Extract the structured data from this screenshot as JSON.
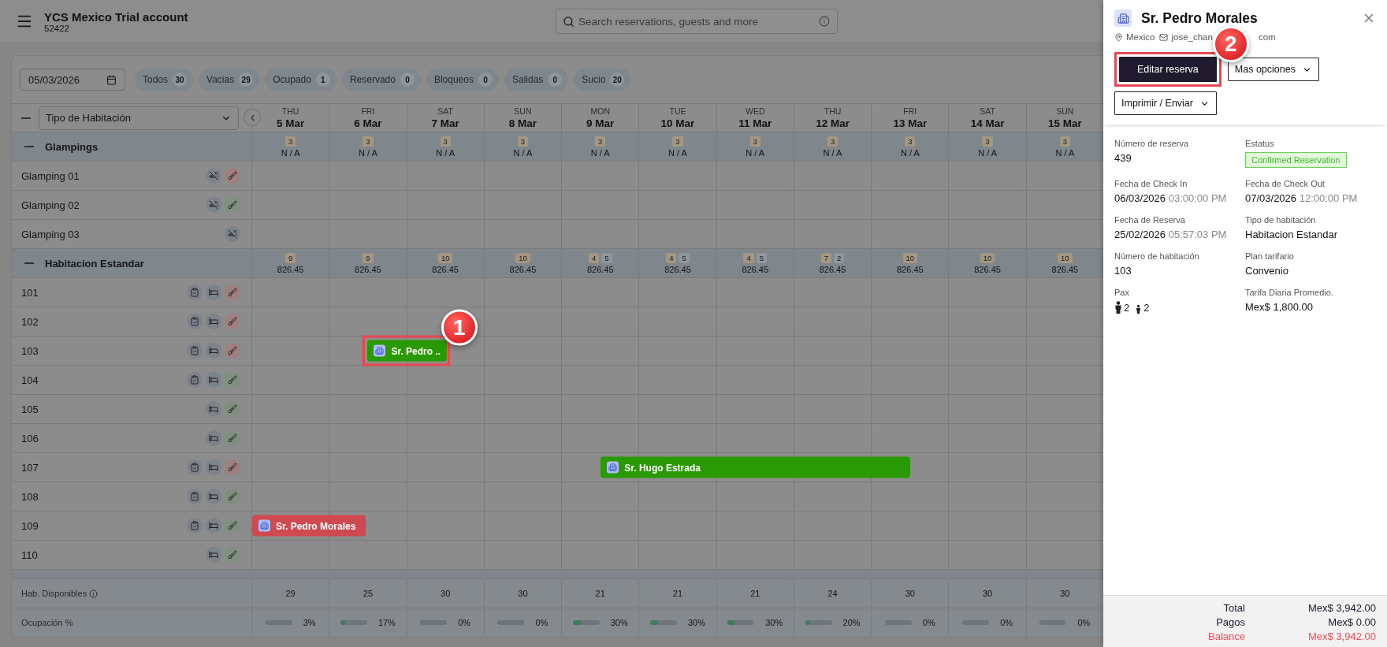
{
  "header": {
    "title": "YCS Mexico Trial account",
    "account_id": "52422",
    "search": {
      "placeholder": "Search reservations, guests and more"
    }
  },
  "filter": {
    "date": "05/03/2026",
    "chips": [
      {
        "label": "Todos",
        "count": "30"
      },
      {
        "label": "Vacias",
        "count": "29"
      },
      {
        "label": "Ocupado",
        "count": "1"
      },
      {
        "label": "Reservado",
        "count": "0"
      },
      {
        "label": "Bloqueos",
        "count": "0"
      },
      {
        "label": "Salidas",
        "count": "0"
      },
      {
        "label": "Sucio",
        "count": "20"
      }
    ]
  },
  "calendar": {
    "group_select": "Tipo de Habitación",
    "days": [
      {
        "weekday": "THU",
        "date": "5 Mar"
      },
      {
        "weekday": "FRI",
        "date": "6 Mar"
      },
      {
        "weekday": "SAT",
        "date": "7 Mar"
      },
      {
        "weekday": "SUN",
        "date": "8 Mar"
      },
      {
        "weekday": "MON",
        "date": "9 Mar"
      },
      {
        "weekday": "TUE",
        "date": "10 Mar"
      },
      {
        "weekday": "WED",
        "date": "11 Mar"
      },
      {
        "weekday": "THU",
        "date": "12 Mar"
      },
      {
        "weekday": "FRI",
        "date": "13 Mar"
      },
      {
        "weekday": "SAT",
        "date": "14 Mar"
      },
      {
        "weekday": "SUN",
        "date": "15 Mar"
      }
    ],
    "groups": [
      {
        "name": "Glampings",
        "expanded": true,
        "summary": [
          {
            "badges": [
              {
                "count": "3",
                "kind": "free"
              }
            ],
            "value": "N / A"
          },
          {
            "badges": [
              {
                "count": "3",
                "kind": "free"
              }
            ],
            "value": "N / A"
          },
          {
            "badges": [
              {
                "count": "3",
                "kind": "free"
              }
            ],
            "value": "N / A"
          },
          {
            "badges": [
              {
                "count": "3",
                "kind": "free"
              }
            ],
            "value": "N / A"
          },
          {
            "badges": [
              {
                "count": "3",
                "kind": "free"
              }
            ],
            "value": "N / A"
          },
          {
            "badges": [
              {
                "count": "3",
                "kind": "free"
              }
            ],
            "value": "N / A"
          },
          {
            "badges": [
              {
                "count": "3",
                "kind": "free"
              }
            ],
            "value": "N / A"
          },
          {
            "badges": [
              {
                "count": "3",
                "kind": "free"
              }
            ],
            "value": "N / A"
          },
          {
            "badges": [
              {
                "count": "3",
                "kind": "free"
              }
            ],
            "value": "N / A"
          },
          {
            "badges": [
              {
                "count": "3",
                "kind": "free"
              }
            ],
            "value": "N / A"
          },
          {
            "badges": [
              {
                "count": "3",
                "kind": "free"
              }
            ],
            "value": "N / A"
          }
        ],
        "rooms": [
          {
            "name": "Glamping 01",
            "icons": [
              {
                "kind": "blocked"
              },
              {
                "kind": "housekeeping",
                "dirty": true
              }
            ]
          },
          {
            "name": "Glamping 02",
            "icons": [
              {
                "kind": "blocked"
              },
              {
                "kind": "housekeeping",
                "dirty": false
              }
            ]
          },
          {
            "name": "Glamping 03",
            "icons": [
              {
                "kind": "blocked"
              }
            ]
          }
        ]
      },
      {
        "name": "Habitacion Estandar",
        "expanded": true,
        "summary": [
          {
            "badges": [
              {
                "count": "9",
                "kind": "free"
              }
            ],
            "value": "826.45"
          },
          {
            "badges": [
              {
                "count": "9",
                "kind": "free"
              }
            ],
            "value": "826.45"
          },
          {
            "badges": [
              {
                "count": "10",
                "kind": "free"
              }
            ],
            "value": "826.45"
          },
          {
            "badges": [
              {
                "count": "10",
                "kind": "free"
              }
            ],
            "value": "826.45"
          },
          {
            "badges": [
              {
                "count": "4",
                "kind": "free"
              },
              {
                "count": "5",
                "kind": "taken"
              }
            ],
            "value": "826.45"
          },
          {
            "badges": [
              {
                "count": "4",
                "kind": "free"
              },
              {
                "count": "5",
                "kind": "taken"
              }
            ],
            "value": "826.45"
          },
          {
            "badges": [
              {
                "count": "4",
                "kind": "free"
              },
              {
                "count": "5",
                "kind": "taken"
              }
            ],
            "value": "826.45"
          },
          {
            "badges": [
              {
                "count": "7",
                "kind": "free"
              },
              {
                "count": "2",
                "kind": "taken"
              }
            ],
            "value": "826.45"
          },
          {
            "badges": [
              {
                "count": "10",
                "kind": "free"
              }
            ],
            "value": "826.45"
          },
          {
            "badges": [
              {
                "count": "10",
                "kind": "free"
              }
            ],
            "value": "826.45"
          },
          {
            "badges": [
              {
                "count": "10",
                "kind": "free"
              }
            ],
            "value": "826.45"
          }
        ],
        "rooms": [
          {
            "name": "101",
            "icons": [
              {
                "kind": "task"
              },
              {
                "kind": "bed"
              },
              {
                "kind": "housekeeping",
                "dirty": true
              }
            ]
          },
          {
            "name": "102",
            "icons": [
              {
                "kind": "task"
              },
              {
                "kind": "bed"
              },
              {
                "kind": "housekeeping",
                "dirty": true
              }
            ]
          },
          {
            "name": "103",
            "icons": [
              {
                "kind": "task"
              },
              {
                "kind": "bed"
              },
              {
                "kind": "housekeeping",
                "dirty": true
              }
            ],
            "reservations": [
              {
                "guest": "Sr. Pedro ..",
                "color": "#2a9a04",
                "highlighted": true,
                "annotation": "1"
              }
            ]
          },
          {
            "name": "104",
            "icons": [
              {
                "kind": "task"
              },
              {
                "kind": "bed"
              },
              {
                "kind": "housekeeping",
                "dirty": false
              }
            ]
          },
          {
            "name": "105",
            "icons": [
              {
                "kind": "bed"
              },
              {
                "kind": "housekeeping",
                "dirty": false
              }
            ]
          },
          {
            "name": "106",
            "icons": [
              {
                "kind": "bed"
              },
              {
                "kind": "housekeeping",
                "dirty": false
              }
            ]
          },
          {
            "name": "107",
            "icons": [
              {
                "kind": "task"
              },
              {
                "kind": "bed"
              },
              {
                "kind": "housekeeping",
                "dirty": true
              }
            ],
            "reservations": [
              {
                "guest": "Sr. Hugo Estrada",
                "color": "#2a9a04",
                "highlighted": false
              }
            ]
          },
          {
            "name": "108",
            "icons": [
              {
                "kind": "task"
              },
              {
                "kind": "bed"
              },
              {
                "kind": "housekeeping",
                "dirty": false
              }
            ]
          },
          {
            "name": "109",
            "icons": [
              {
                "kind": "task"
              },
              {
                "kind": "bed"
              },
              {
                "kind": "housekeeping",
                "dirty": false
              }
            ],
            "reservations": [
              {
                "guest": "Sr. Pedro Morales",
                "color": "#cf4a50",
                "highlighted": false
              }
            ]
          },
          {
            "name": "110",
            "icons": [
              {
                "kind": "bed"
              },
              {
                "kind": "housekeeping",
                "dirty": false
              }
            ]
          }
        ]
      }
    ],
    "available": {
      "label": "Hab. Disponibles",
      "values": [
        "29",
        "25",
        "30",
        "30",
        "21",
        "21",
        "21",
        "24",
        "30",
        "30",
        "30"
      ]
    },
    "occupancy": {
      "label": "Ocupación %",
      "cells": [
        {
          "level": 0.03,
          "text": "3%"
        },
        {
          "level": 0.17,
          "text": "17%"
        },
        {
          "level": 0,
          "text": "0%"
        },
        {
          "level": 0,
          "text": "0%"
        },
        {
          "level": 0.3,
          "text": "30%"
        },
        {
          "level": 0.3,
          "text": "30%"
        },
        {
          "level": 0.3,
          "text": "30%"
        },
        {
          "level": 0.2,
          "text": "20%"
        },
        {
          "level": 0,
          "text": "0%"
        },
        {
          "level": 0,
          "text": "0%"
        },
        {
          "level": 0,
          "text": "0%"
        }
      ]
    }
  },
  "reservation_panel": {
    "guest": "Sr. Pedro Morales",
    "country": "Mexico",
    "email_start": "jose_chan",
    "email_end": "com",
    "actions": [
      {
        "label": "Editar reserva",
        "kind": "primary",
        "highlighted": true,
        "annotation": "2"
      },
      {
        "label": "Mas opciones",
        "kind": "dropdown",
        "highlighted": false
      },
      {
        "label": "Imprimir / Enviar",
        "kind": "dropdown",
        "highlighted": false
      }
    ],
    "fields": [
      {
        "label": "Número de reserva",
        "kind": "text",
        "value": "439"
      },
      {
        "label": "Estatus",
        "kind": "status",
        "value": "Confirmed Reservation"
      },
      {
        "label": "Fecha de Check In",
        "kind": "datetime",
        "value": "06/03/2026",
        "time": "03:00:00 PM"
      },
      {
        "label": "Fecha de Check Out",
        "kind": "datetime",
        "value": "07/03/2026",
        "time": "12:00:00 PM"
      },
      {
        "label": "Fecha de Reserva",
        "kind": "datetime",
        "value": "25/02/2026",
        "time": "05:57:03 PM"
      },
      {
        "label": "Tipo de habitación",
        "kind": "text",
        "value": "Habitacion Estandar"
      },
      {
        "label": "Número de habitación",
        "kind": "text",
        "value": "103"
      },
      {
        "label": "Plan tarifario",
        "kind": "text",
        "value": "Convenio"
      },
      {
        "label": "Pax",
        "kind": "pax",
        "adults": "2",
        "children": "2"
      },
      {
        "label": "Tarifa Diaria Promedio.",
        "kind": "text",
        "value": "Mex$ 1,800.00"
      }
    ],
    "totals": [
      {
        "label": "Total",
        "value": "Mex$ 3,942.00",
        "alert": false
      },
      {
        "label": "Pagos",
        "value": "Mex$ 0.00",
        "alert": false
      },
      {
        "label": "Balance",
        "value": "Mex$ 3,942.00",
        "alert": true
      }
    ]
  }
}
